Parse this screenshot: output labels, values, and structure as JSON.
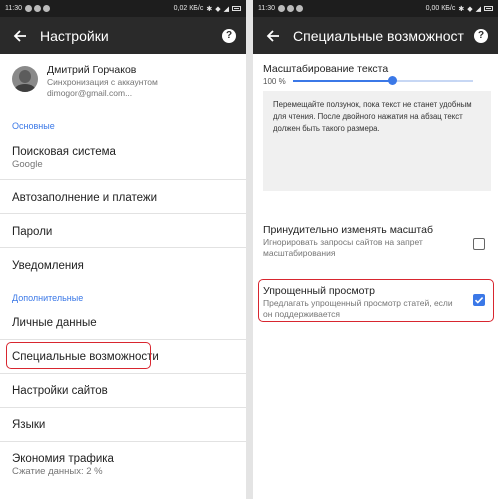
{
  "left": {
    "status": {
      "time": "11:30",
      "net_speed": "0,02 КБ/с"
    },
    "appbar": {
      "title": "Настройки",
      "help": "?"
    },
    "account": {
      "name": "Дмитрий Горчаков",
      "sync": "Синхронизация с аккаунтом",
      "email": "dimogor@gmail.com..."
    },
    "sections": {
      "basic": "Основные",
      "advanced": "Дополнительные"
    },
    "items": {
      "search": {
        "title": "Поисковая система",
        "sub": "Google"
      },
      "autofill": "Автозаполнение и платежи",
      "passwords": "Пароли",
      "notifications": "Уведомления",
      "personal": "Личные данные",
      "accessibility": "Специальные возможности",
      "site_settings": "Настройки сайтов",
      "languages": "Языки",
      "data_saver": {
        "title": "Экономия трафика",
        "sub": "Сжатие данных: 2 %"
      }
    }
  },
  "right": {
    "status": {
      "time": "11:30",
      "net_speed": "0,00 КБ/с"
    },
    "appbar": {
      "title": "Специальные возможности",
      "help": "?"
    },
    "text_scaling": {
      "label": "Масштабирование текста",
      "percent": "100 %",
      "level": 0.55,
      "preview": "Перемещайте ползунок, пока текст не станет удобным для чтения. После двойного нажатия на абзац текст должен быть такого размера."
    },
    "force_zoom": {
      "title": "Принудительно изменять масштаб",
      "sub": "Игнорировать запросы сайтов на запрет масштабирования",
      "checked": false
    },
    "simplified_view": {
      "title": "Упрощенный просмотр",
      "sub": "Предлагать упрощенный просмотр статей, если он поддерживается",
      "checked": true
    }
  },
  "colors": {
    "accent": "#3b78e7",
    "highlight": "#d8262f",
    "appbar": "#2a2a2a",
    "statusbar": "#1d1d1d"
  }
}
